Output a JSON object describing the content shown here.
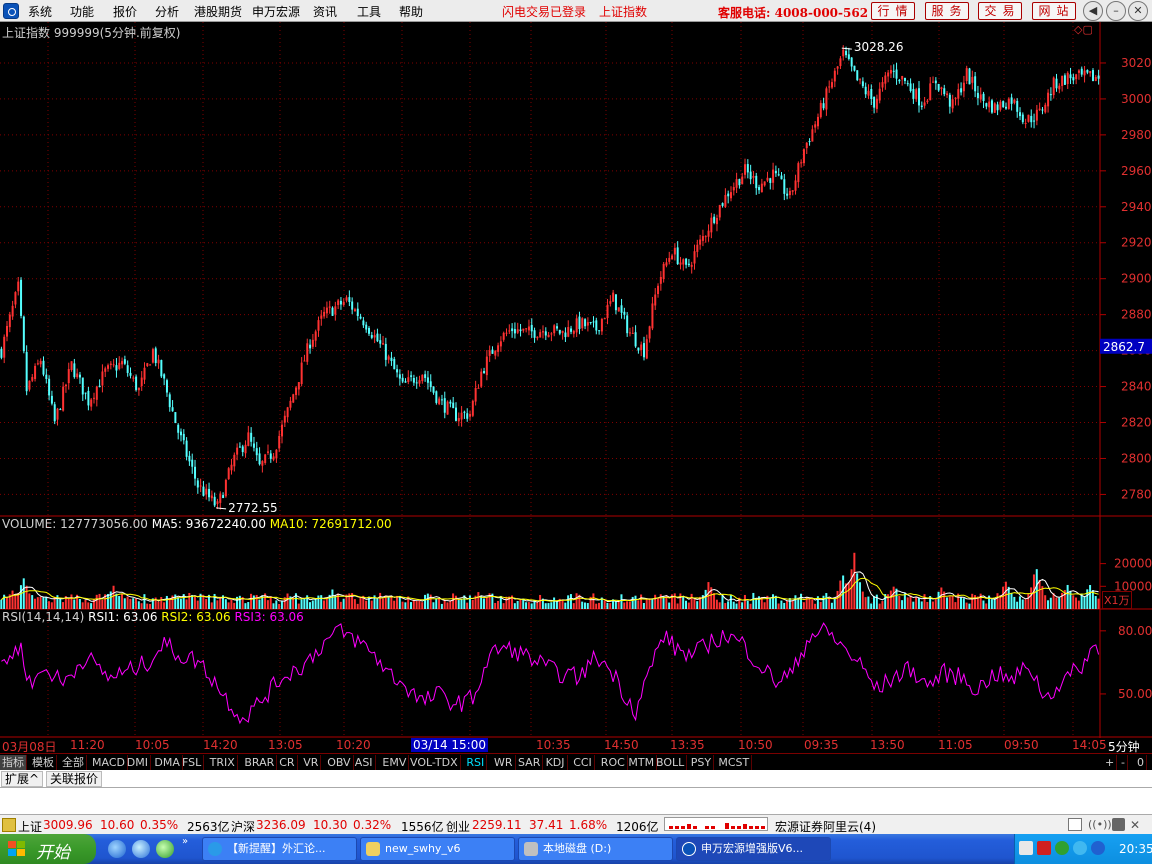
{
  "menubar": {
    "items": [
      "系统",
      "功能",
      "报价",
      "分析",
      "港股期货",
      "申万宏源",
      "资讯",
      "工具",
      "帮助"
    ],
    "notice1": "闪电交易已登录",
    "notice2": "上证指数",
    "hotline": "客服电话: 4008-000-562",
    "buttons": [
      "行情",
      "服务",
      "交易",
      "网站"
    ]
  },
  "chart_header": "上证指数 999999(5分钟.前复权)",
  "colors": {
    "up": "#ff3232",
    "down": "#54ffff",
    "ma5": "#ffffff",
    "ma10": "#ffff00",
    "rsi": "#ff00ff",
    "axis": "#b00000",
    "grid": "#800000"
  },
  "price_labels": {
    "high": "3028.26",
    "low": "2772.55",
    "current": "2862.7"
  },
  "volume_header": {
    "volume_label": "VOLUME: 127773056.00",
    "ma5_label": "MA5: 93672240.00",
    "ma10_label": "MA10: 72691712.00"
  },
  "volume_unit": "X1万",
  "rsi_header": {
    "title": "RSI(14,14,14)",
    "rsi1": "RSI1: 63.06",
    "rsi2": "RSI2: 63.06",
    "rsi3": "RSI3: 63.06"
  },
  "time_axis": {
    "labels": [
      "03月08日",
      "11:20",
      "10:05",
      "14:20",
      "13:05",
      "10:20",
      "",
      "",
      "10:35",
      "14:50",
      "13:35",
      "10:50",
      "09:35",
      "13:50",
      "11:05",
      "09:50",
      "14:05"
    ],
    "cursor": "03/14 15:00",
    "period": "5分钟"
  },
  "indicator_tabs": [
    "指标",
    "模板",
    "全部",
    "MACD",
    "DMI",
    "DMA",
    "FSL",
    "TRIX",
    "BRAR",
    "CR",
    "VR",
    "OBV",
    "ASI",
    "EMV",
    "VOL-TDX",
    "RSI",
    "WR",
    "SAR",
    "KDJ",
    "CCI",
    "ROC",
    "MTM",
    "BOLL",
    "PSY",
    "MCST"
  ],
  "active_tab": "RSI",
  "tab_controls": [
    "+",
    "-",
    "0"
  ],
  "ext_tabs": [
    "扩展^",
    "关联报价"
  ],
  "statusbar": {
    "sh_name": "上证",
    "sh_value": "3009.96",
    "sh_change": "10.60",
    "sh_pct": "0.35%",
    "sh_amount": "2563亿",
    "hs_name": "沪深",
    "hs_value": "3236.09",
    "hs_change": "10.30",
    "hs_pct": "0.32%",
    "hs_amount": "1556亿",
    "cy_name": "创业",
    "cy_value": "2259.11",
    "cy_change": "37.41",
    "cy_pct": "1.68%",
    "cy_amount": "1206亿",
    "broker": "宏源证券阿里云(4)"
  },
  "taskbar": {
    "start": "开始",
    "tasks": [
      "【新提醒】外汇论...",
      "new_swhy_v6",
      "本地磁盘 (D:)",
      "申万宏源增强版V6..."
    ],
    "clock": "20:35"
  },
  "chart_data": [
    {
      "type": "candlestick",
      "title": "上证指数 999999(5分钟.前复权)",
      "y_ticks": [
        2780,
        2800,
        2820,
        2840,
        2860,
        2880,
        2900,
        2920,
        2940,
        2960,
        2980,
        3000,
        3020
      ],
      "ylim": [
        2768,
        3035
      ],
      "annotations": [
        {
          "label": "3028.26",
          "value": 3028.26
        },
        {
          "label": "2772.55",
          "value": 2772.55
        },
        {
          "label": "2862.7",
          "value": 2862.7
        }
      ],
      "trend_points": [
        [
          0,
          2860
        ],
        [
          6,
          2895
        ],
        [
          9,
          2838
        ],
        [
          14,
          2855
        ],
        [
          19,
          2820
        ],
        [
          25,
          2852
        ],
        [
          31,
          2832
        ],
        [
          37,
          2848
        ],
        [
          43,
          2853
        ],
        [
          49,
          2838
        ],
        [
          54,
          2860
        ],
        [
          58,
          2842
        ],
        [
          63,
          2815
        ],
        [
          70,
          2785
        ],
        [
          77,
          2773
        ],
        [
          83,
          2800
        ],
        [
          88,
          2812
        ],
        [
          92,
          2795
        ],
        [
          97,
          2804
        ],
        [
          102,
          2826
        ],
        [
          110,
          2865
        ],
        [
          115,
          2880
        ],
        [
          123,
          2888
        ],
        [
          130,
          2875
        ],
        [
          137,
          2858
        ],
        [
          143,
          2840
        ],
        [
          150,
          2848
        ],
        [
          156,
          2832
        ],
        [
          162,
          2824
        ],
        [
          167,
          2825
        ],
        [
          171,
          2848
        ],
        [
          177,
          2866
        ],
        [
          182,
          2872
        ],
        [
          188,
          2870
        ],
        [
          194,
          2872
        ],
        [
          200,
          2870
        ],
        [
          206,
          2875
        ],
        [
          212,
          2872
        ],
        [
          218,
          2889
        ],
        [
          224,
          2870
        ],
        [
          229,
          2860
        ],
        [
          234,
          2898
        ],
        [
          239,
          2916
        ],
        [
          244,
          2905
        ],
        [
          249,
          2920
        ],
        [
          254,
          2935
        ],
        [
          259,
          2948
        ],
        [
          265,
          2960
        ],
        [
          270,
          2952
        ],
        [
          275,
          2958
        ],
        [
          281,
          2945
        ],
        [
          286,
          2972
        ],
        [
          291,
          2990
        ],
        [
          296,
          3010
        ],
        [
          300,
          3025
        ],
        [
          305,
          3010
        ],
        [
          311,
          2998
        ],
        [
          317,
          3016
        ],
        [
          322,
          3010
        ],
        [
          328,
          2998
        ],
        [
          333,
          3010
        ],
        [
          339,
          2996
        ],
        [
          344,
          3014
        ],
        [
          349,
          3000
        ],
        [
          354,
          2995
        ],
        [
          360,
          3000
        ],
        [
          365,
          2988
        ],
        [
          370,
          2992
        ],
        [
          375,
          3008
        ],
        [
          380,
          3012
        ]
      ],
      "volatility": 4.0
    },
    {
      "type": "bar",
      "title": "VOLUME",
      "y_ticks": [
        10000,
        20000
      ],
      "unit": "X1万",
      "ylim": [
        0,
        26000
      ],
      "base": 5500,
      "spikes": [
        [
          4,
          9500
        ],
        [
          8,
          14000
        ],
        [
          40,
          10500
        ],
        [
          118,
          9000
        ],
        [
          170,
          8500
        ],
        [
          252,
          12500
        ],
        [
          300,
          17000
        ],
        [
          304,
          24800
        ],
        [
          318,
          12000
        ],
        [
          335,
          10000
        ],
        [
          358,
          13000
        ],
        [
          368,
          12500
        ],
        [
          369,
          20500
        ],
        [
          380,
          11000
        ],
        [
          388,
          11500
        ]
      ],
      "ma_lines": [
        {
          "name": "MA5",
          "color": "#ffffff"
        },
        {
          "name": "MA10",
          "color": "#ffff00"
        }
      ]
    },
    {
      "type": "line",
      "title": "RSI(14,14,14)",
      "y_ticks": [
        50.0,
        80.0
      ],
      "ylim": [
        30,
        88
      ],
      "series": [
        {
          "name": "RSI1",
          "color": "#ff00ff"
        }
      ],
      "trend_points": [
        [
          0,
          65
        ],
        [
          7,
          72
        ],
        [
          10,
          55
        ],
        [
          16,
          62
        ],
        [
          22,
          55
        ],
        [
          30,
          68
        ],
        [
          38,
          58
        ],
        [
          44,
          60
        ],
        [
          52,
          65
        ],
        [
          58,
          74
        ],
        [
          64,
          68
        ],
        [
          70,
          66
        ],
        [
          76,
          56
        ],
        [
          80,
          48
        ],
        [
          86,
          38
        ],
        [
          92,
          46
        ],
        [
          100,
          58
        ],
        [
          108,
          64
        ],
        [
          114,
          73
        ],
        [
          120,
          80
        ],
        [
          126,
          76
        ],
        [
          132,
          70
        ],
        [
          138,
          60
        ],
        [
          144,
          54
        ],
        [
          150,
          46
        ],
        [
          156,
          50
        ],
        [
          162,
          45
        ],
        [
          168,
          48
        ],
        [
          174,
          68
        ],
        [
          178,
          72
        ],
        [
          184,
          70
        ],
        [
          190,
          66
        ],
        [
          198,
          60
        ],
        [
          206,
          58
        ],
        [
          212,
          68
        ],
        [
          218,
          60
        ],
        [
          222,
          50
        ],
        [
          226,
          42
        ],
        [
          232,
          65
        ],
        [
          236,
          78
        ],
        [
          240,
          72
        ],
        [
          246,
          68
        ],
        [
          252,
          74
        ],
        [
          258,
          78
        ],
        [
          264,
          74
        ],
        [
          270,
          64
        ],
        [
          276,
          56
        ],
        [
          282,
          60
        ],
        [
          288,
          78
        ],
        [
          294,
          80
        ],
        [
          300,
          72
        ],
        [
          306,
          64
        ],
        [
          312,
          52
        ],
        [
          318,
          58
        ],
        [
          324,
          62
        ],
        [
          330,
          54
        ],
        [
          336,
          60
        ],
        [
          342,
          58
        ],
        [
          348,
          52
        ],
        [
          354,
          60
        ],
        [
          360,
          56
        ],
        [
          366,
          64
        ],
        [
          372,
          48
        ],
        [
          378,
          56
        ],
        [
          384,
          62
        ],
        [
          390,
          73
        ]
      ],
      "volatility": 4.5,
      "last_value": 63.06
    }
  ]
}
